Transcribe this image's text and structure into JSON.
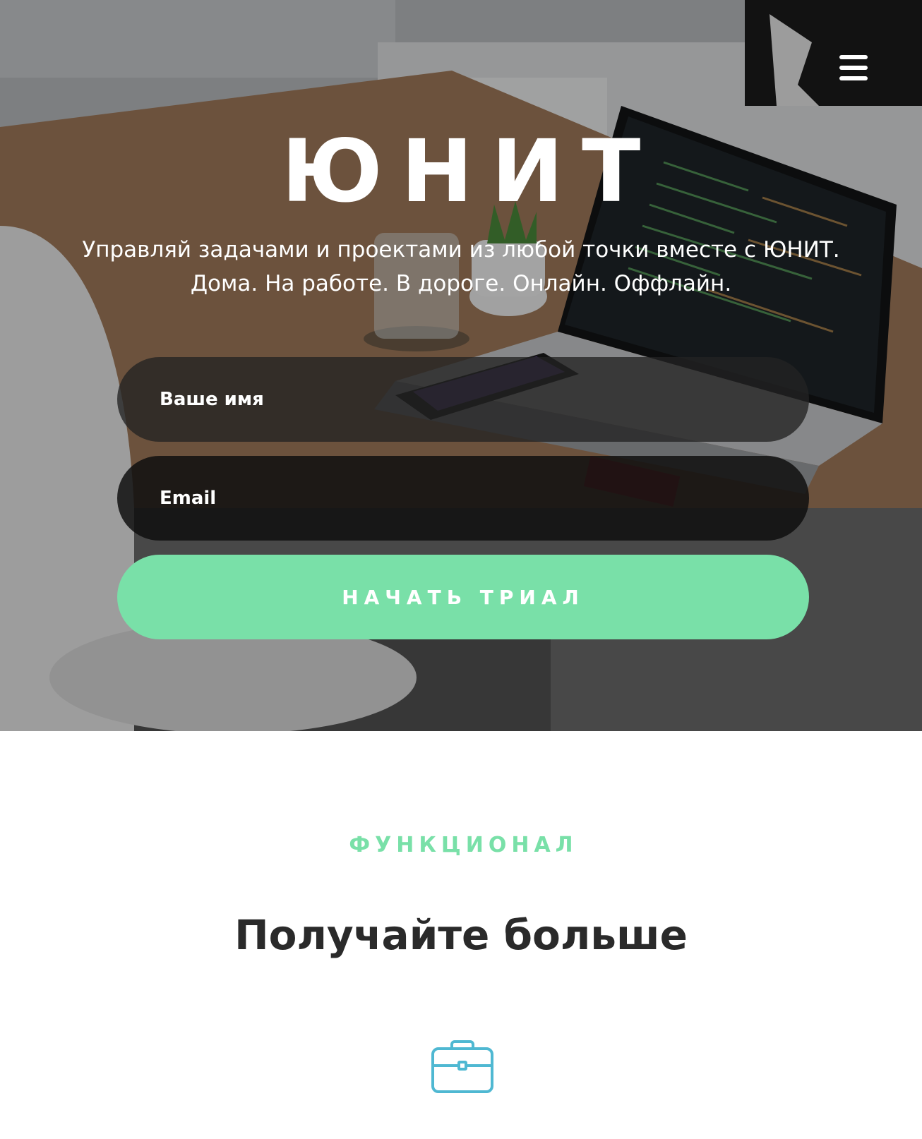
{
  "header": {
    "menu_icon": "hamburger-menu-icon"
  },
  "hero": {
    "brand": "ЮНИТ",
    "tagline_line1": "Управляй задачами и проектами из любой точки вместе с ЮНИТ.",
    "tagline_line2": "Дома. На работе. В дороге. Онлайн. Оффлайн.",
    "form": {
      "name_placeholder": "Ваше имя",
      "email_placeholder": "Email",
      "submit_label": "НАЧАТЬ ТРИАЛ"
    }
  },
  "features": {
    "eyebrow": "ФУНКЦИОНАЛ",
    "title": "Получайте больше",
    "icon": "briefcase-icon"
  },
  "colors": {
    "accent": "#79e0a8",
    "icon": "#4fb8d2",
    "heading": "#2a2a2a"
  }
}
